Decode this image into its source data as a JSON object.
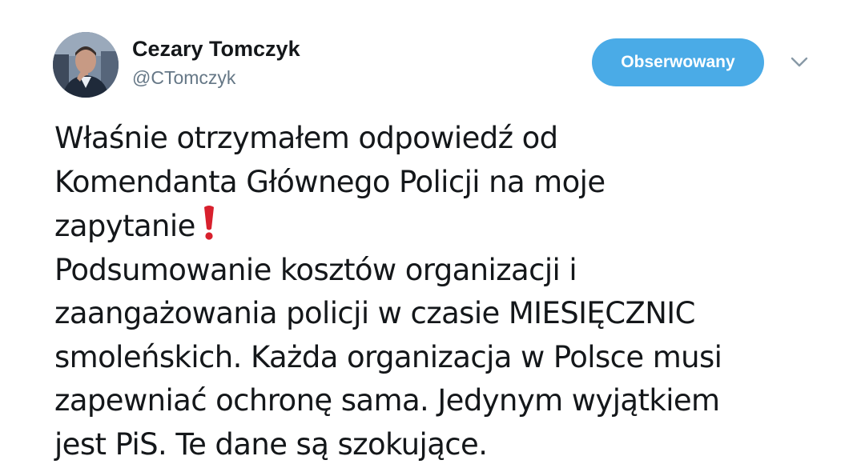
{
  "author": {
    "display_name": "Cezary Tomczyk",
    "handle": "@CTomczyk",
    "avatar_icon": "profile-photo"
  },
  "follow_button": {
    "label": "Obserwowany",
    "color": "#4aabe7"
  },
  "menu": {
    "icon": "chevron-down-icon"
  },
  "tweet": {
    "lines": [
      "Właśnie otrzymałem odpowiedź od",
      "Komendanta Głównego Policji na moje",
      "zapytanie",
      "Podsumowanie kosztów organizacji i",
      "zaangażowania policji w czasie MIESIĘCZNIC",
      "smoleńskich. Każda organizacja w Polsce musi",
      "zapewniać ochronę sama. Jedynym wyjątkiem",
      "jest PiS. Te dane są szokujące."
    ],
    "emoji": "heavy-exclamation-mark-icon",
    "emoji_color": "#d8202d"
  },
  "colors": {
    "text": "#14171a",
    "secondary_text": "#657786"
  }
}
